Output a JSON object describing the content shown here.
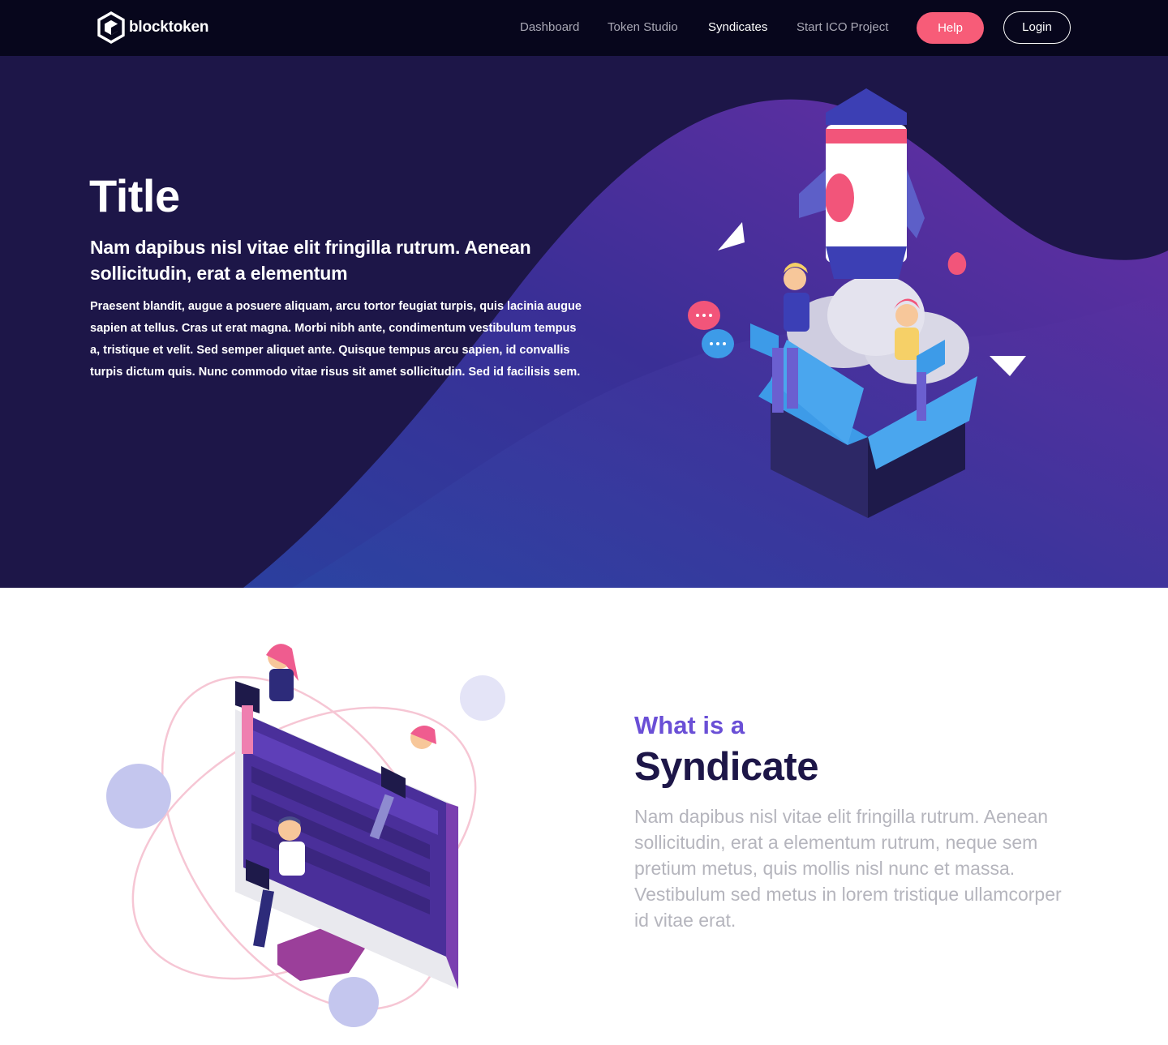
{
  "brand": {
    "name": "blocktoken",
    "logo_icon": "hexagon-cube-icon"
  },
  "nav": {
    "links": [
      {
        "label": "Dashboard",
        "active": false
      },
      {
        "label": "Token Studio",
        "active": false
      },
      {
        "label": "Syndicates",
        "active": true
      },
      {
        "label": "Start ICO Project",
        "active": false
      }
    ],
    "help_label": "Help",
    "login_label": "Login"
  },
  "hero": {
    "title": "Title",
    "subtitle": "Nam dapibus nisl vitae elit fringilla rutrum. Aenean sollicitudin, erat a elementum",
    "body": " Praesent blandit, augue a posuere aliquam, arcu tortor feugiat turpis, quis lacinia augue sapien at tellus. Cras ut erat magna. Morbi nibh ante, condimentum vestibulum tempus a, tristique et velit. Sed semper aliquet ante. Quisque tempus arcu sapien, id convallis turpis dictum quis. Nunc commodo vitae risus sit amet sollicitudin. Sed id facilisis sem."
  },
  "syndicate": {
    "eyebrow": "What is a",
    "heading": "Syndicate",
    "body": "Nam dapibus nisl vitae elit fringilla rutrum. Aenean sollicitudin, erat a elementum rutrum, neque sem pretium metus, quis mollis nisl nunc et massa. Vestibulum sed metus in lorem tristique ullamcorper id vitae erat."
  },
  "colors": {
    "nav_bg": "#07061c",
    "hero_bg": "#1d1648",
    "accent_pink": "#f75c78",
    "accent_purple": "#6a4fd6",
    "heading_dark": "#1d1648",
    "body_gray": "#b5b5bd"
  }
}
